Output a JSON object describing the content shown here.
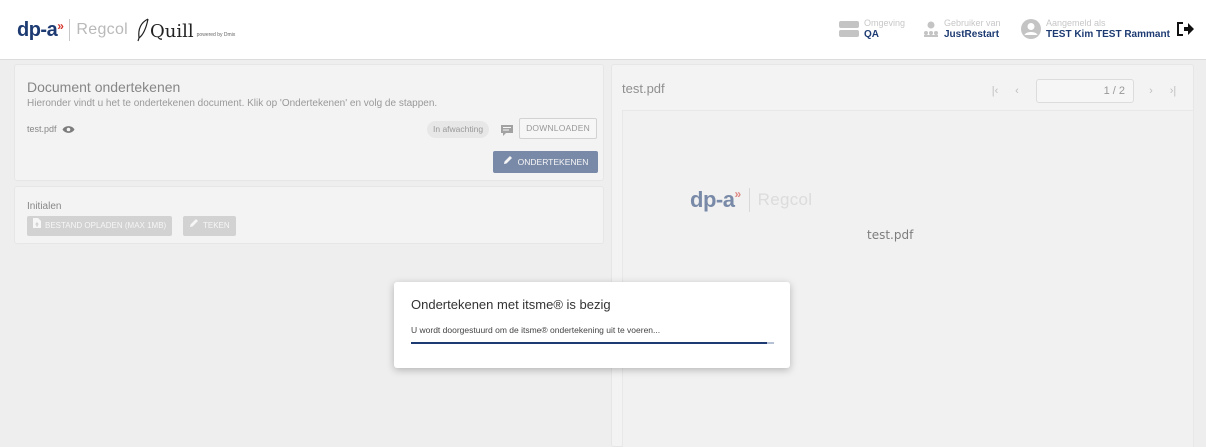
{
  "header": {
    "logo_brand": "dp-a",
    "logo_regcol": "Regcol",
    "logo_quill": "Quill",
    "logo_quill_sub": "powered by Dmix",
    "environment_label": "Omgeving",
    "environment_value": "QA",
    "user_label": "Gebruiker van",
    "user_value": "JustRestart",
    "signedin_label": "Aangemeld als",
    "signedin_value": "TEST Kim TEST Rammant",
    "icons": [
      "server-icon",
      "users-icon",
      "user-avatar-icon",
      "logout-icon"
    ]
  },
  "document": {
    "title": "Document ondertekenen",
    "subtitle": "Hieronder vindt u het te ondertekenen document. Klik op 'Ondertekenen' en volg de stappen.",
    "filename": "test.pdf",
    "status": "In afwachting",
    "download_label": "DOWNLOADEN",
    "sign_label": "ONDERTEKENEN"
  },
  "initials": {
    "title": "Initialen",
    "upload_label": "BESTAND OPLADEN (MAX 1MB)",
    "draw_label": "TEKEN"
  },
  "viewer": {
    "title": "test.pdf",
    "page_value": "1 / 2",
    "pdf_logo_brand": "dp-a",
    "pdf_logo_regcol": "Regcol",
    "pdf_filename": "test.pdf"
  },
  "modal": {
    "title": "Ondertekenen met itsme® is bezig",
    "message": "U wordt doorgestuurd om de itsme® ondertekening uit te voeren...",
    "progress": 0.98
  },
  "colors": {
    "brand": "#1d3b72",
    "accent": "#d4342a",
    "disabled": "#bdbdbd"
  }
}
